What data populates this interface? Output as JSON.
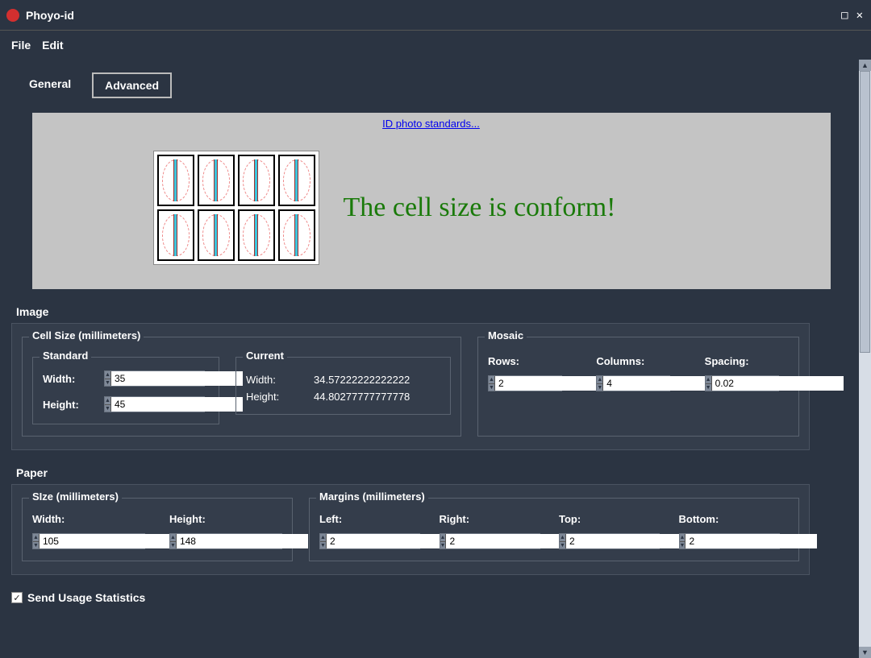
{
  "window": {
    "title": "Phoyo-id"
  },
  "menubar": {
    "file": "File",
    "edit": "Edit"
  },
  "tabs": {
    "general": "General",
    "advanced": "Advanced"
  },
  "preview": {
    "link": "ID photo standards...",
    "conform_message": "The cell size is conform!"
  },
  "image_section": {
    "title": "Image",
    "cell_size": {
      "legend": "Cell Size (millimeters)",
      "standard": {
        "legend": "Standard",
        "width_label": "Width:",
        "width_value": "35",
        "height_label": "Height:",
        "height_value": "45"
      },
      "current": {
        "legend": "Current",
        "width_label": "Width:",
        "width_value": "34.57222222222222",
        "height_label": "Height:",
        "height_value": "44.80277777777778"
      }
    },
    "mosaic": {
      "legend": "Mosaic",
      "rows_label": "Rows:",
      "rows_value": "2",
      "columns_label": "Columns:",
      "columns_value": "4",
      "spacing_label": "Spacing:",
      "spacing_value": "0.02"
    }
  },
  "paper_section": {
    "title": "Paper",
    "size": {
      "legend": "SIze (millimeters)",
      "width_label": "Width:",
      "width_value": "105",
      "height_label": "Height:",
      "height_value": "148"
    },
    "margins": {
      "legend": "Margins (millimeters)",
      "left_label": "Left:",
      "left_value": "2",
      "right_label": "Right:",
      "right_value": "2",
      "top_label": "Top:",
      "top_value": "2",
      "bottom_label": "Bottom:",
      "bottom_value": "2"
    }
  },
  "footer": {
    "send_stats_label": "Send Usage Statistics",
    "send_stats_checked": true
  }
}
